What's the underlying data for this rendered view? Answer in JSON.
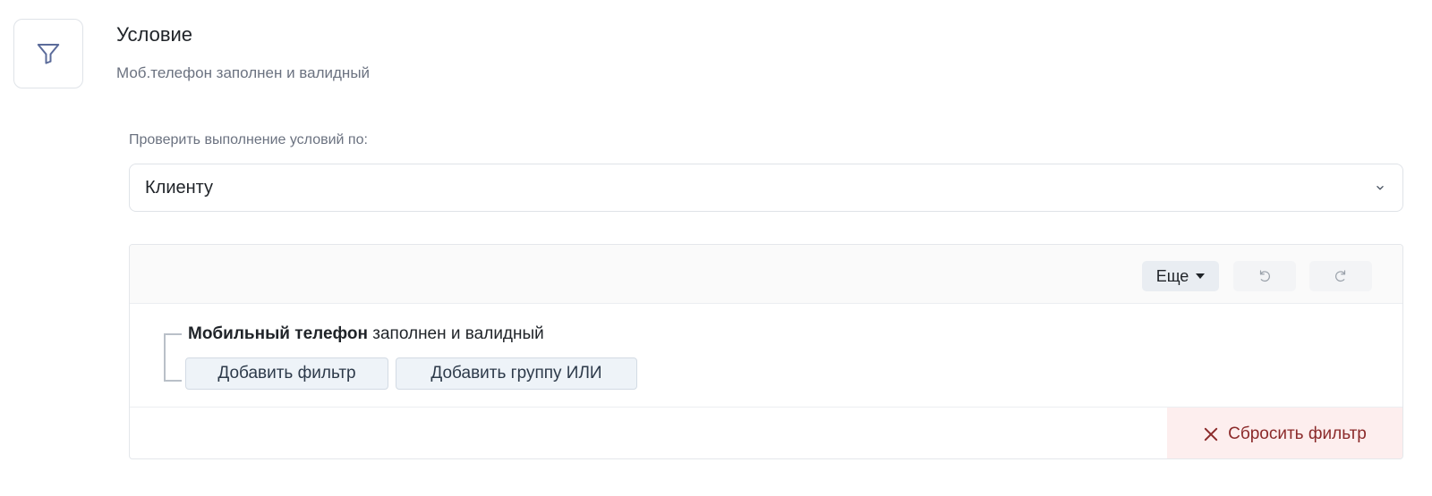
{
  "header": {
    "title": "Условие",
    "subtitle": "Моб.телефон заполнен и валидный",
    "icon": "filter-icon"
  },
  "check_by": {
    "label": "Проверить выполнение условий по:",
    "selected": "Клиенту",
    "icon": "chevron-down-icon"
  },
  "filter_panel": {
    "toolbar": {
      "more_label": "Еще",
      "undo_icon": "undo-icon",
      "redo_icon": "redo-icon"
    },
    "rule": {
      "field": "Мобильный телефон",
      "condition": " заполнен и валидный"
    },
    "add_filter_label": "Добавить фильтр",
    "add_or_group_label": "Добавить группу ИЛИ",
    "reset_label": "Сбросить фильтр",
    "reset_icon": "close-icon"
  },
  "colors": {
    "accent_icon": "#5b6b9a",
    "reset_bg": "#fdeeee",
    "reset_text": "#8b2a2a",
    "button_bg": "#eef3f8"
  }
}
